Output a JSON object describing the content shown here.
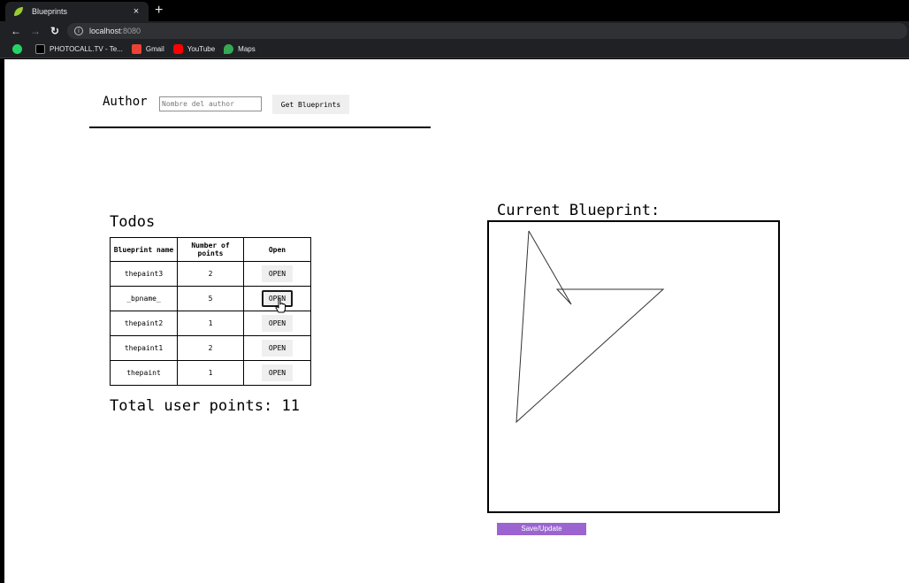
{
  "browser": {
    "tab_title": "Blueprints",
    "tab_close": "×",
    "new_tab": "+",
    "url_host": "localhost",
    "url_port": ":8080",
    "bookmarks": [
      {
        "label": "",
        "icon": "whatsapp-icon",
        "color": "#25d366"
      },
      {
        "label": "PHOTOCALL.TV - Te...",
        "icon": "page-icon",
        "color": "#000000"
      },
      {
        "label": "Gmail",
        "icon": "gmail-icon",
        "color": "#ea4335"
      },
      {
        "label": "YouTube",
        "icon": "youtube-icon",
        "color": "#ff0000"
      },
      {
        "label": "Maps",
        "icon": "maps-icon",
        "color": "#34a853"
      }
    ]
  },
  "author": {
    "label": "Author",
    "placeholder": "Nombre del author",
    "get_button": "Get Blueprints"
  },
  "todos": {
    "title": "Todos",
    "headers": [
      "Blueprint name",
      "Number of points",
      "Open"
    ],
    "rows": [
      {
        "name": "thepaint3",
        "points": "2",
        "open": "OPEN"
      },
      {
        "name": "_bpname_",
        "points": "5",
        "open": "OPEN"
      },
      {
        "name": "thepaint2",
        "points": "1",
        "open": "OPEN"
      },
      {
        "name": "thepaint1",
        "points": "2",
        "open": "OPEN"
      },
      {
        "name": "thepaint",
        "points": "1",
        "open": "OPEN"
      }
    ],
    "total": "Total user points: 11"
  },
  "current": {
    "title": "Current Blueprint:",
    "save_button": "Save/Update",
    "save_color": "#9b64d0",
    "drawing_points": [
      [
        45,
        10
      ],
      [
        93,
        93
      ],
      [
        77,
        76
      ],
      [
        197,
        76
      ],
      [
        31,
        226
      ],
      [
        45,
        10
      ]
    ]
  }
}
